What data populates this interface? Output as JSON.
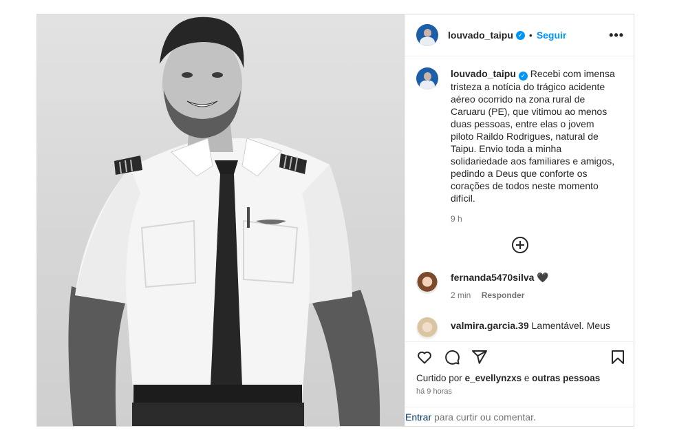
{
  "post": {
    "username": "louvado_taipu",
    "follow_label": "Seguir",
    "more_label": "•••",
    "caption": "Recebi com imensa tristeza a notícia do trágico acidente aéreo ocorrido na zona rural de Caruaru (PE), que vitimou ao menos duas pessoas, entre elas o jovem piloto Raildo Rodrigues, natural de Taipu. Envio toda a minha solidariedade aos familiares e amigos, pedindo a Deus que conforte os corações de todos neste momento difícil.",
    "caption_time": "9 h"
  },
  "comments": [
    {
      "username": "fernanda5470silva",
      "text": "🖤",
      "time": "2 min",
      "reply_label": "Responder"
    },
    {
      "username": "valmira.garcia.39",
      "text": "Lamentável. Meus"
    }
  ],
  "footer": {
    "liked_prefix": "Curtido por",
    "liked_user": "e_evellynzxs",
    "liked_suffix": "e",
    "liked_others": "outras pessoas",
    "posted_ago": "há 9 horas",
    "login_link": "Entrar",
    "login_text": "para curtir ou comentar."
  },
  "icons": {
    "verified": "verified-badge-icon",
    "like": "heart-icon",
    "comment": "comment-icon",
    "share": "share-icon",
    "save": "bookmark-icon",
    "load_more": "plus-circle-icon"
  },
  "colors": {
    "accent": "#0095f6",
    "link_dark": "#00376b",
    "muted": "#737373"
  }
}
